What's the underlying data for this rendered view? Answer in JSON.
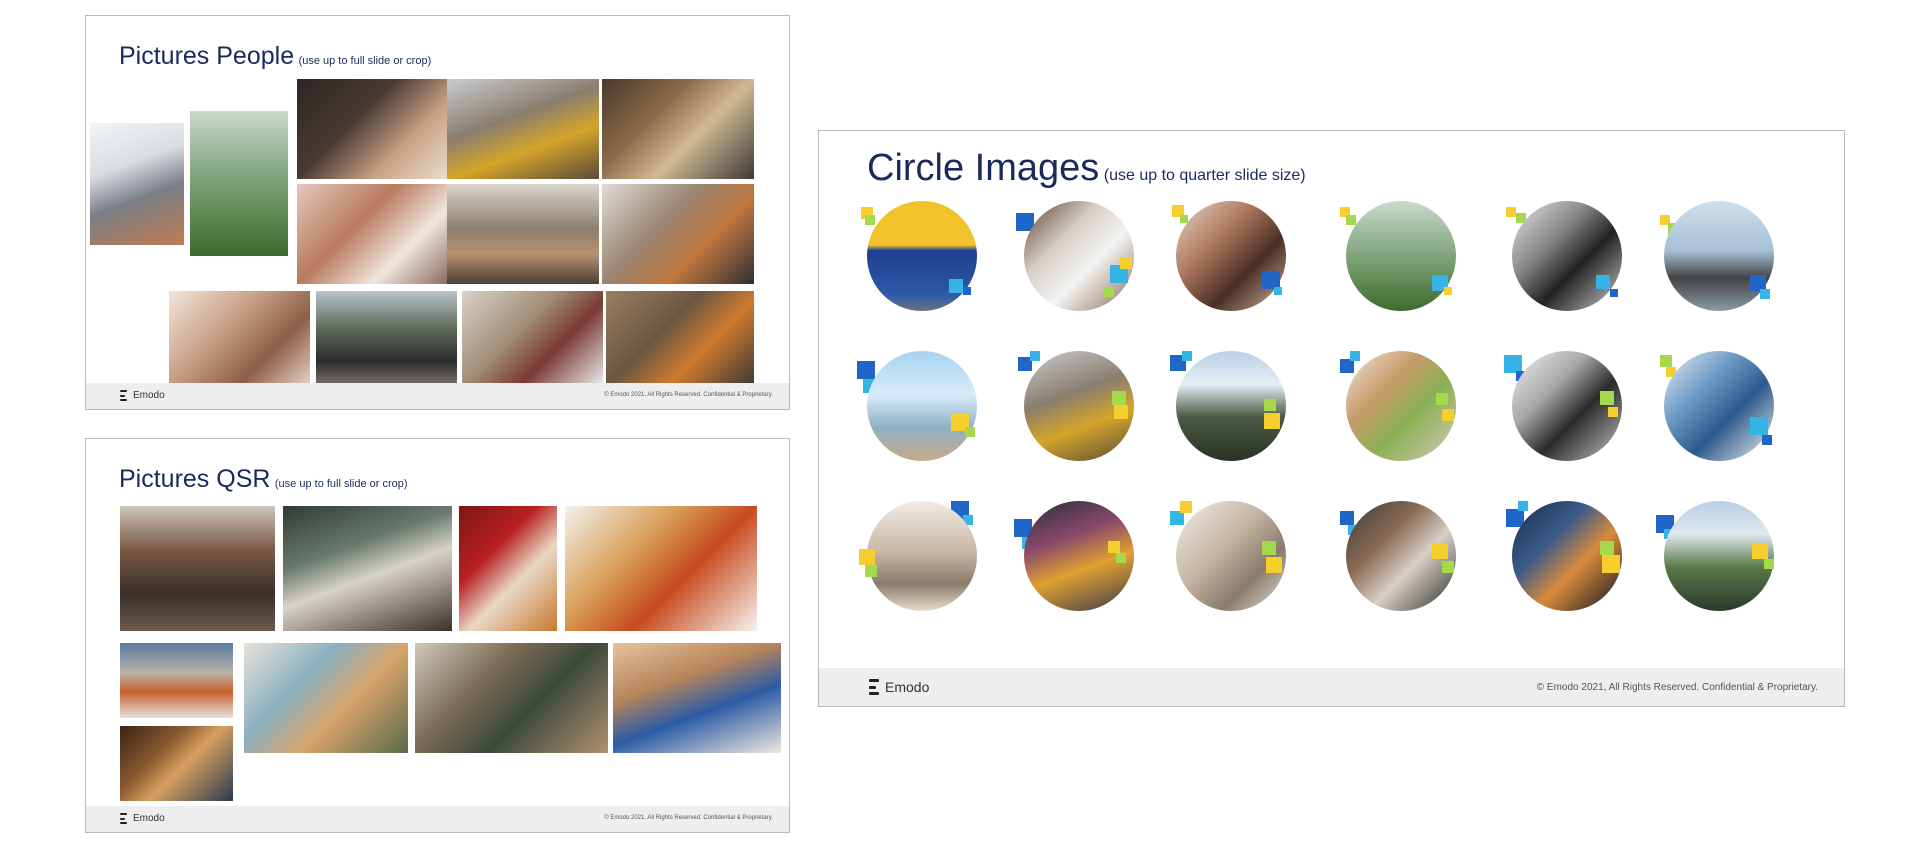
{
  "slides": {
    "people": {
      "title": "Pictures People",
      "note": "(use up to full slide or crop)",
      "brand": "Emodo",
      "copyright": "© Emodo 2021, All Rights Reserved. Confidential & Proprietary.",
      "photos": [
        {
          "label": "basketball-court-players",
          "bg": "linear-gradient(160deg,#f2f4f6 0%,#d9dde2 35%,#7a7f86 60%,#c07a52 100%)"
        },
        {
          "label": "woman-in-greenhouse",
          "bg": "linear-gradient(180deg,#c9d9cc 0%,#7fa47a 45%,#3d6b2c 100%)"
        },
        {
          "label": "woman-with-laptop-neon-cafe",
          "bg": "linear-gradient(135deg,#2c2623 0%,#4a3b33 40%,#c9a486 70%,#e8dccf 100%)"
        },
        {
          "label": "friends-sitting-on-steps",
          "bg": "linear-gradient(160deg,#c8ccd0 0%,#8a7e6e 40%,#d4a42a 65%,#5a4a3a 100%)"
        },
        {
          "label": "woman-with-phone-flower-market",
          "bg": "linear-gradient(135deg,#4a3a2a 0%,#8a6a4a 35%,#d0b890 60%,#3c3a38 100%)"
        },
        {
          "label": "woman-laughing-with-coffee",
          "bg": "linear-gradient(135deg,#e3c9bd 0%,#b87a5e 40%,#f0e6dd 70%,#8b6c60 100%)"
        },
        {
          "label": "family-dinner-table",
          "bg": "linear-gradient(180deg,#d9d4cc 0%,#8c7e6e 45%,#b89270 70%,#4a3f35 100%)"
        },
        {
          "label": "friends-looking-at-phones",
          "bg": "linear-gradient(135deg,#e0dcd6 0%,#9a8470 40%,#c0773e 65%,#2f2f33 100%)"
        },
        {
          "label": "mother-and-child-with-father",
          "bg": "linear-gradient(135deg,#f2e6dc 0%,#c79d84 40%,#8c5e48 70%,#e6d2c4 100%)"
        },
        {
          "label": "three-friends-park",
          "bg": "linear-gradient(180deg,#b7c4c9 0%,#5e6b5c 40%,#2b2b2b 75%,#767069 100%)"
        },
        {
          "label": "man-writing-outdoor-cafe",
          "bg": "linear-gradient(135deg,#d8d2c8 0%,#a38f79 40%,#7a3a34 65%,#eaeaea 100%)"
        },
        {
          "label": "man-on-bench-phone",
          "bg": "linear-gradient(135deg,#9a8060 0%,#6a5642 40%,#d07a2e 65%,#3c3a34 100%)"
        }
      ]
    },
    "qsr": {
      "title": "Pictures QSR",
      "note": "(use up to full slide or crop)",
      "brand": "Emodo",
      "copyright": "© Emodo 2021, All Rights Reserved. Confidential & Proprietary.",
      "photos": [
        {
          "label": "restaurant-interior-brick",
          "bg": "linear-gradient(180deg,#cfc6bc 0%,#7a5a44 35%,#3b2f28 70%,#6b5a4c 100%)"
        },
        {
          "label": "busy-cafe-interior",
          "bg": "linear-gradient(160deg,#2f3a33 0%,#6a7a6e 35%,#d8d3c8 55%,#3a302a 100%)"
        },
        {
          "label": "ketchup-on-hot-dog",
          "bg": "linear-gradient(135deg,#7c1515 0%,#b82020 35%,#e8d7c5 60%,#c9792e 100%)"
        },
        {
          "label": "pizza-slices-and-soda",
          "bg": "linear-gradient(135deg,#f4f1ee 0%,#d9a05a 35%,#c64a1e 60%,#f7f3ef 100%)"
        },
        {
          "label": "fast-food-tray",
          "bg": "linear-gradient(180deg,#5a7aa0 0%,#b9b3a8 40%,#c9602e 65%,#e7e2dc 100%)"
        },
        {
          "label": "friends-toasting-drinks",
          "bg": "linear-gradient(135deg,#e8e2d8 0%,#8ab0c0 35%,#d8a46c 60%,#5a6a4a 100%)"
        },
        {
          "label": "friends-dining-table",
          "bg": "linear-gradient(135deg,#d0c8b8 0%,#7a6a54 35%,#3c4a3a 60%,#b09070 100%)"
        },
        {
          "label": "friends-with-fast-food",
          "bg": "linear-gradient(160deg,#e6c39a 0%,#b7845a 35%,#2c5ca6 60%,#efe8de 100%)"
        },
        {
          "label": "friends-restaurant-night",
          "bg": "linear-gradient(135deg,#3a2418 0%,#8a5a30 35%,#d8a060 55%,#2a3a52 100%)"
        }
      ]
    },
    "circles": {
      "title": "Circle Images",
      "note": "(use up to quarter slide size)",
      "brand": "Emodo",
      "copyright": "© Emodo 2021, All Rights Reserved. Confidential & Proprietary.",
      "items": [
        {
          "label": "shopping-carts",
          "bg": "linear-gradient(180deg,#f2c22a 0%,#f2c22a 40%,#1e3f8f 45%,#2c5aa8 85%,#6a7080 100%)"
        },
        {
          "label": "hand-holding-phone-car",
          "bg": "linear-gradient(135deg,#5a4030 0%,#d7cfc7 35%,#f3f3f3 60%,#8a6a50 100%)"
        },
        {
          "label": "women-taking-selfie",
          "bg": "linear-gradient(135deg,#e8d8cc 0%,#b07a60 35%,#4a2f24 65%,#d0b4a0 100%)"
        },
        {
          "label": "woman-greenhouse",
          "bg": "linear-gradient(180deg,#c9d9cc 0%,#7fa47a 50%,#3d6b2c 100%)"
        },
        {
          "label": "business-handshake",
          "bg": "linear-gradient(135deg,#e6e6e6 0%,#8a8a8a 35%,#222 60%,#cfcfcf 100%)"
        },
        {
          "label": "woman-running-rooftop",
          "bg": "linear-gradient(180deg,#cfe0ec 0%,#a7c0d6 45%,#444 70%,#8a9aa6 100%)"
        },
        {
          "label": "basketball-hoop-beach",
          "bg": "linear-gradient(180deg,#a9d2f0 0%,#d7ecfb 40%,#8fb0c4 70%,#c7ab86 100%)"
        },
        {
          "label": "friends-sitting-steps",
          "bg": "linear-gradient(160deg,#c8ccd0 0%,#8a7e6e 40%,#d4a42a 65%,#5a4a3a 100%)"
        },
        {
          "label": "mountain-landscape",
          "bg": "linear-gradient(180deg,#b8d0e6 0%,#e6eef5 30%,#4a5a44 60%,#2a3222 100%)"
        },
        {
          "label": "friends-toasting",
          "bg": "linear-gradient(135deg,#f0e8dc 0%,#c69a6a 35%,#8ab054 60%,#d8c8b8 100%)"
        },
        {
          "label": "business-meeting-office",
          "bg": "linear-gradient(135deg,#f2f2f2 0%,#a8a8a8 35%,#2a2a2a 60%,#c8c8c8 100%)"
        },
        {
          "label": "person-in-striped-shirt",
          "bg": "linear-gradient(135deg,#e8eef4 0%,#6a9ac4 35%,#2c5a8c 60%,#f0f0f0 100%)"
        },
        {
          "label": "retail-store-interior",
          "bg": "linear-gradient(180deg,#f0ece6 0%,#c9b9a6 45%,#8a7a6a 75%,#e8dcc8 100%)"
        },
        {
          "label": "taxi-in-city",
          "bg": "linear-gradient(160deg,#2a2a3a 0%,#8a4a6a 35%,#e0a030 60%,#3a3a4a 100%)"
        },
        {
          "label": "family-on-sofa",
          "bg": "linear-gradient(135deg,#f0ece6 0%,#c9b9a6 40%,#8a7a6a 70%,#e6e2dc 100%)"
        },
        {
          "label": "man-driving-car",
          "bg": "linear-gradient(135deg,#3a3a3a 0%,#8a6a54 35%,#d8d0c6 60%,#2a2a2a 100%)"
        },
        {
          "label": "hand-using-phone-night",
          "bg": "linear-gradient(135deg,#1a2a4a 0%,#3a5a8a 35%,#d88a3a 60%,#0a1426 100%)"
        },
        {
          "label": "city-aerial-view",
          "bg": "linear-gradient(180deg,#b8d0e6 0%,#dfe8f0 30%,#5a7a4a 60%,#2a3a2a 100%)"
        }
      ]
    }
  },
  "colors": {
    "title": "#1b2a5c",
    "accent_blue": "#1f66c8",
    "accent_cyan": "#35b4e6",
    "accent_yellow": "#f6cf2e",
    "accent_green": "#a3d94a",
    "footer_bg": "#eeeeee"
  }
}
